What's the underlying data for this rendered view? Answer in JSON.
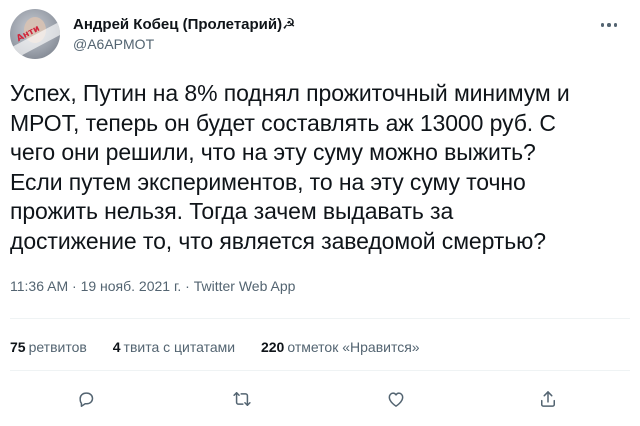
{
  "author": {
    "display_name": "Андрей Кобец (Пролетарий)☭",
    "handle": "@A6APMOT",
    "avatar_text": "Анти"
  },
  "tweet": {
    "text": "Успех, Путин на 8% поднял прожиточный минимум и\nМРОТ, теперь он будет составлять аж 13000 руб. С\nчего они решили, что на эту суму можно выжить?\nЕсли путем экспериментов, то на эту суму точно\nпрожить нельзя. Тогда зачем выдавать за\nдостижение то, что является заведомой смертью?",
    "time": "11:36 AM",
    "separator": "·",
    "date": "19 нояб. 2021 г.",
    "source": "Twitter Web App"
  },
  "stats": {
    "retweets_count": "75",
    "retweets_label": "ретвитов",
    "quotes_count": "4",
    "quotes_label": "твита с цитатами",
    "likes_count": "220",
    "likes_label": "отметок «Нравится»"
  },
  "actions": [
    "reply-icon",
    "retweet-icon",
    "like-icon",
    "share-icon"
  ],
  "colors": {
    "text": "#0f1419",
    "secondary": "#536471",
    "divider": "#eff3f4"
  }
}
